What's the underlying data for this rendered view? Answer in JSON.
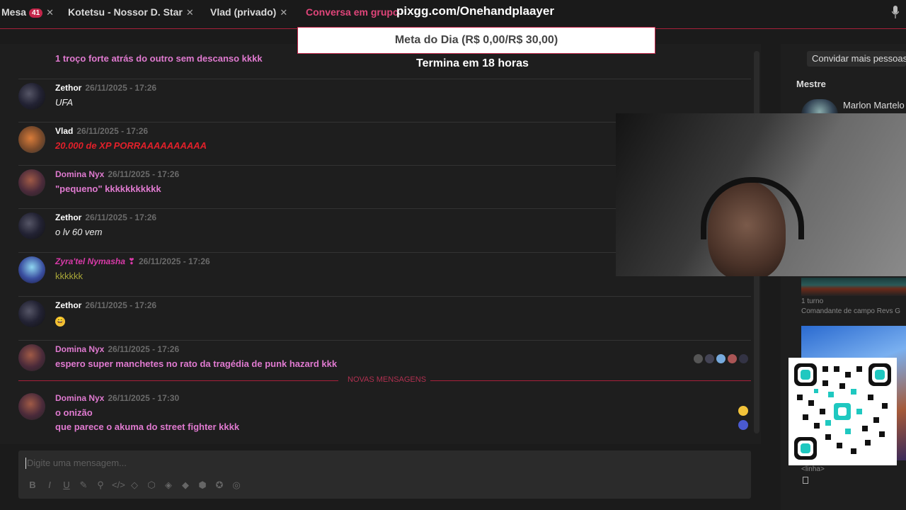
{
  "tabs": [
    {
      "label": "Mesa",
      "badge": "41"
    },
    {
      "label": "Kotetsu - Nossor D. Star"
    },
    {
      "label": "Vlad (privado)"
    },
    {
      "label": "Conversa em grupo"
    }
  ],
  "overlay": {
    "url": "pixgg.com/Onehandplaayer",
    "goal": "Meta do Dia (R$ 0,00/R$ 30,00)",
    "ends": "Termina em 18 horas"
  },
  "messages": [
    {
      "name": "",
      "ts": "",
      "text": "1 troço forte atrás do outro sem descanso kkkk"
    },
    {
      "name": "Zethor",
      "ts": "26/11/2025 - 17:26",
      "text": "UFA"
    },
    {
      "name": "Vlad",
      "ts": "26/11/2025 - 17:26",
      "text": "20.000 de XP PORRAAAAAAAAAA"
    },
    {
      "name": "Domina Nyx",
      "ts": "26/11/2025 - 17:26",
      "text": "\"pequeno\" kkkkkkkkkkk"
    },
    {
      "name": "Zethor",
      "ts": "26/11/2025 - 17:26",
      "text": "o lv 60 vem"
    },
    {
      "name": "Zyra'tel Nymasha",
      "ts": "26/11/2025 - 17:26",
      "text": "kkkkkk"
    },
    {
      "name": "Zethor",
      "ts": "26/11/2025 - 17:26",
      "text": "😄"
    },
    {
      "name": "Domina Nyx",
      "ts": "26/11/2025 - 17:26",
      "text": "espero super manchetes no rato da tragédia de punk hazard kkk"
    },
    {
      "name": "Domina Nyx",
      "ts": "26/11/2025 - 17:30",
      "text": "o onizão",
      "text2": "que parece o akuma do street fighter kkkk"
    }
  ],
  "divider": "NOVAS MENSAGENS",
  "composer": {
    "placeholder": "Digite uma mensagem..."
  },
  "right": {
    "invite": "Convidar mais pessoas",
    "mestre": "Mestre",
    "master_name": "Marlon Martelo",
    "turno": "1 turno",
    "comandante": "Comandante de campo Revs G",
    "linha": "<linha>"
  },
  "colors": {
    "accent": "#c4264a",
    "pink": "#e07ad0",
    "red": "#e2202a"
  }
}
